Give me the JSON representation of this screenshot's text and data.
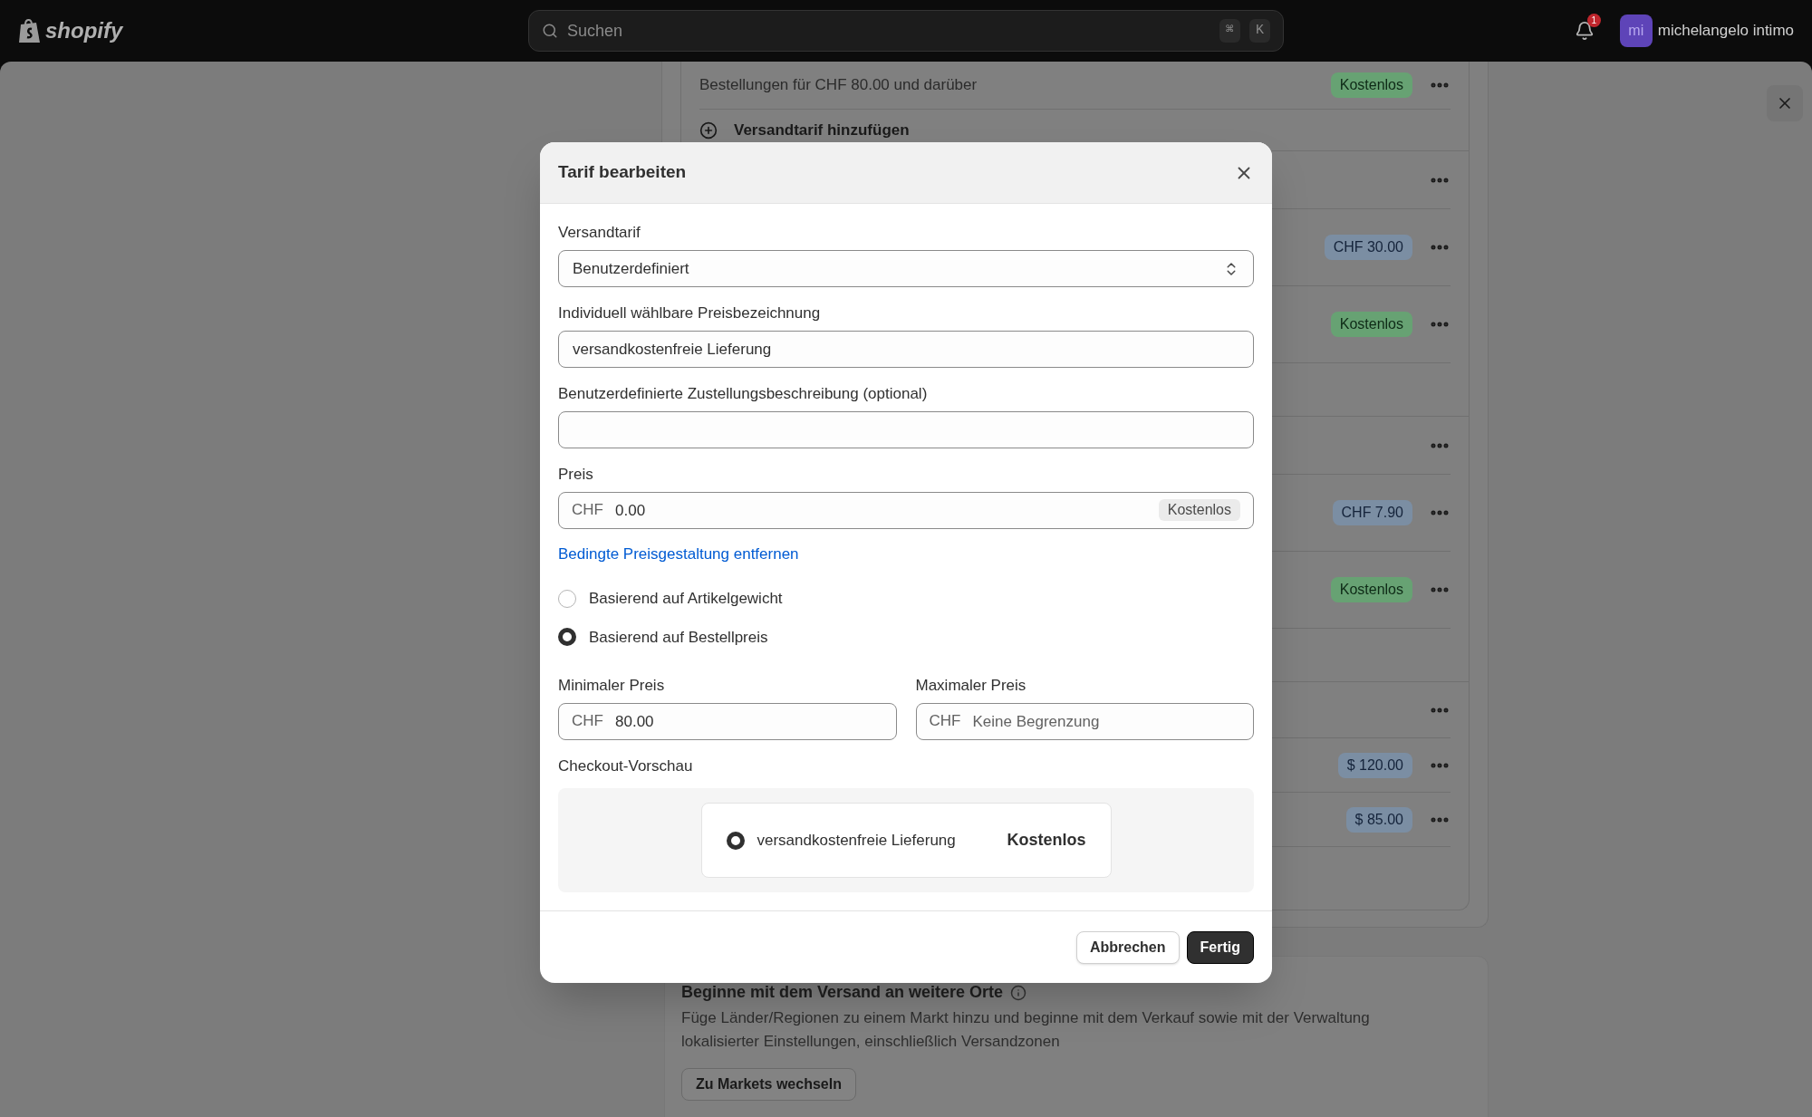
{
  "top_bar": {
    "logo": "shopify",
    "search": {
      "placeholder": "Suchen",
      "shortcut": [
        "⌘",
        "K"
      ]
    },
    "notifications": {
      "count": "1"
    },
    "user": {
      "initials": "mi",
      "name": "michelangelo intimo"
    }
  },
  "background": {
    "first_row": {
      "text": "Bestellungen für CHF 80.00 und darüber",
      "badge": {
        "text": "Kostenlos",
        "kind": "success"
      }
    },
    "add_rate": "Versandtarif hinzufügen",
    "groups": [
      {
        "rows": [
          {
            "kind": "header"
          },
          {
            "kind": "rate",
            "badge": {
              "text": "CHF 30.00",
              "kind": "info"
            }
          },
          {
            "kind": "rate",
            "badge": {
              "text": "Kostenlos",
              "kind": "success"
            }
          }
        ]
      },
      {
        "rows": [
          {
            "kind": "header"
          },
          {
            "kind": "rate",
            "badge": {
              "text": "CHF 7.90",
              "kind": "info"
            }
          },
          {
            "kind": "rate",
            "badge": {
              "text": "Kostenlos",
              "kind": "success"
            }
          }
        ]
      },
      {
        "rows": [
          {
            "kind": "header"
          },
          {
            "kind": "rate",
            "badge": {
              "text": "$ 120.00",
              "kind": "info"
            }
          },
          {
            "kind": "rate",
            "badge": {
              "text": "$ 85.00",
              "kind": "info"
            }
          }
        ]
      }
    ],
    "markets_card": {
      "title": "Beginne mit dem Versand an weitere Orte",
      "description": "Füge Länder/Regionen zu einem Markt hinzu und beginne mit dem Verkauf sowie mit der Verwaltung lokalisierter Einstellungen, einschließlich Versandzonen",
      "button": "Zu Markets wechseln"
    }
  },
  "dialog": {
    "title": "Tarif bearbeiten",
    "rate_select": {
      "label": "Versandtarif",
      "value": "Benutzerdefiniert"
    },
    "name_field": {
      "label": "Individuell wählbare Preisbezeichnung",
      "value": "versandkostenfreie Lieferung"
    },
    "description_field": {
      "label": "Benutzerdefinierte Zustellungsbeschreibung (optional)"
    },
    "price_field": {
      "label": "Preis",
      "prefix": "CHF",
      "value": "0.00",
      "badge": "Kostenlos"
    },
    "remove_link": "Bedingte Preisgestaltung entfernen",
    "condition_options": [
      {
        "label": "Basierend auf Artikelgewicht",
        "selected": false
      },
      {
        "label": "Basierend auf Bestellpreis",
        "selected": true
      }
    ],
    "min_price": {
      "label": "Minimaler Preis",
      "prefix": "CHF",
      "value": "80.00"
    },
    "max_price": {
      "label": "Maximaler Preis",
      "prefix": "CHF",
      "placeholder": "Keine Begrenzung"
    },
    "checkout_preview": {
      "label": "Checkout-Vorschau",
      "option": {
        "name": "versandkostenfreie Lieferung",
        "price": "Kostenlos",
        "selected": true
      }
    },
    "buttons": [
      {
        "label": "Abbrechen",
        "kind": "secondary"
      },
      {
        "label": "Fertig",
        "kind": "primary"
      }
    ]
  }
}
